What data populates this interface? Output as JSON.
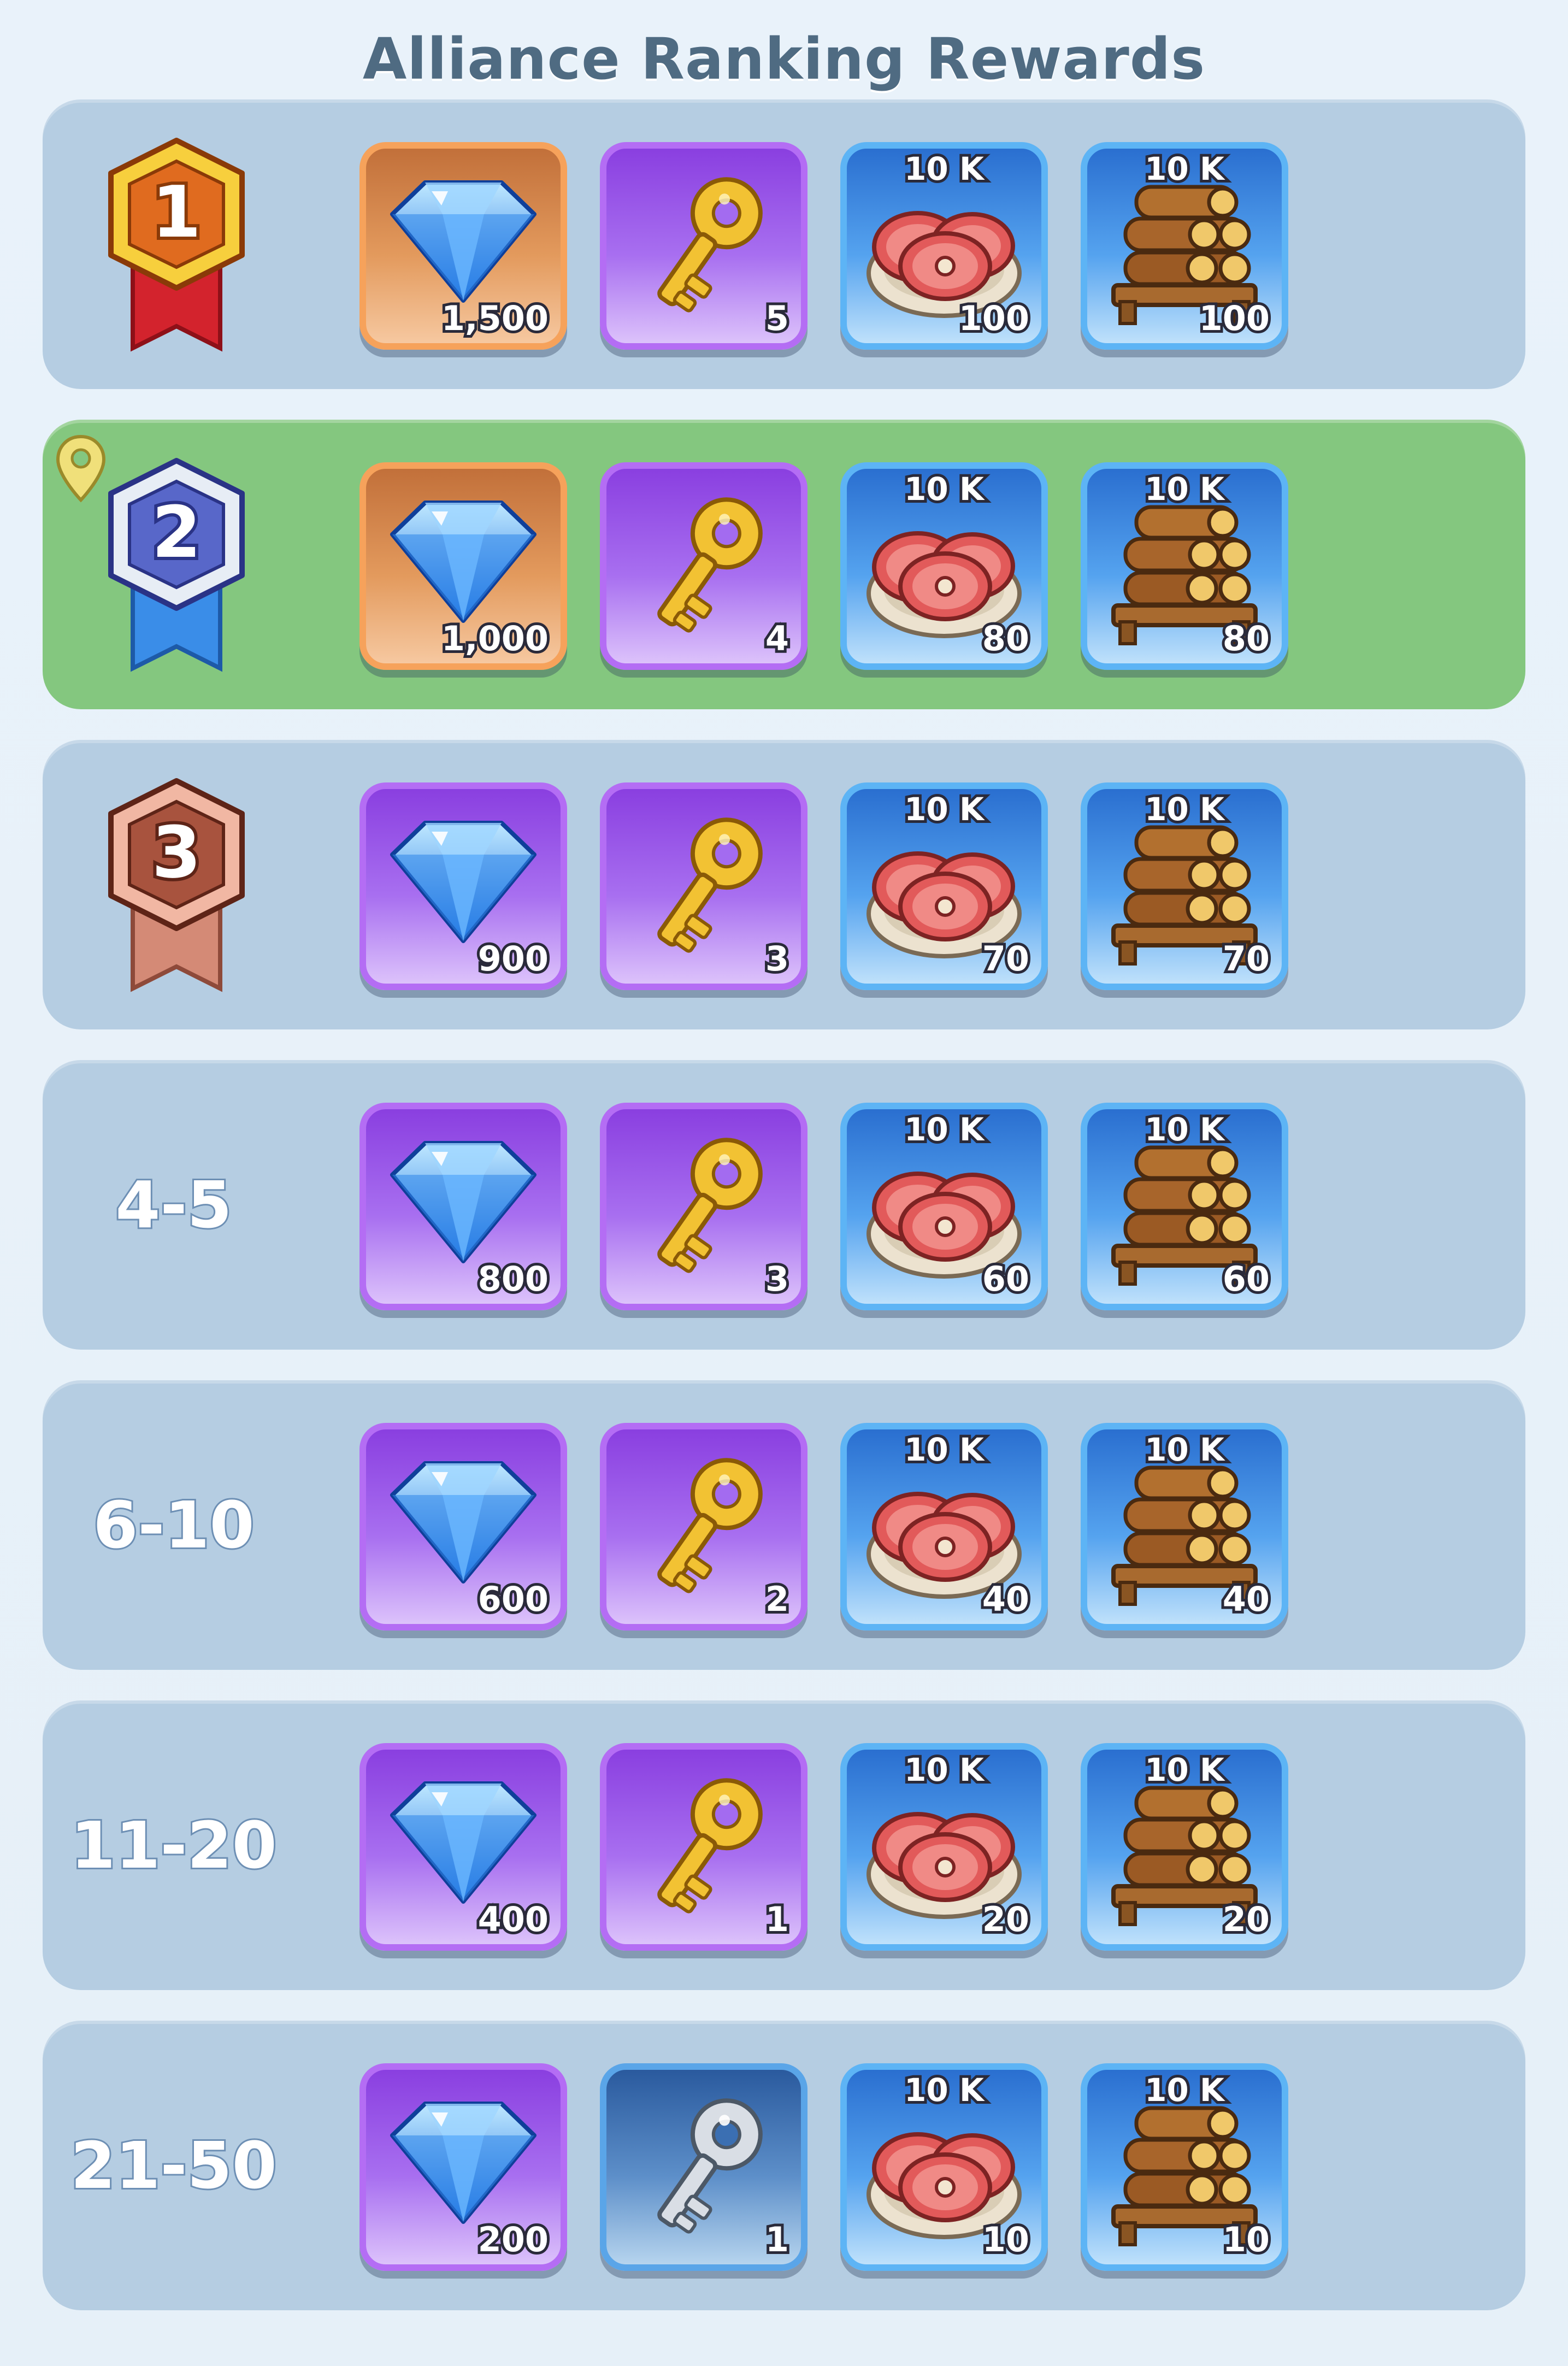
{
  "title": "Alliance Ranking Rewards",
  "colors": {
    "row_bg": "#b5cde2",
    "row_highlight": "#84c77f",
    "card_orange": "#f6a25b",
    "card_purple": "#b46df4",
    "card_blue": "#5db4f5"
  },
  "resource_tag": "10 K",
  "rows": [
    {
      "rank": "1",
      "rank_type": "gold-medal",
      "highlight": false,
      "rewards": [
        {
          "item": "diamond-icon",
          "frame": "orange",
          "qty": "1,500"
        },
        {
          "item": "gold-key-icon",
          "frame": "purple",
          "qty": "5"
        },
        {
          "item": "meat-icon",
          "frame": "blue",
          "qty": "100"
        },
        {
          "item": "wood-icon",
          "frame": "blue",
          "qty": "100"
        }
      ]
    },
    {
      "rank": "2",
      "rank_type": "silver-medal",
      "highlight": true,
      "rewards": [
        {
          "item": "diamond-icon",
          "frame": "orange",
          "qty": "1,000"
        },
        {
          "item": "gold-key-icon",
          "frame": "purple",
          "qty": "4"
        },
        {
          "item": "meat-icon",
          "frame": "blue",
          "qty": "80"
        },
        {
          "item": "wood-icon",
          "frame": "blue",
          "qty": "80"
        }
      ]
    },
    {
      "rank": "3",
      "rank_type": "bronze-medal",
      "highlight": false,
      "rewards": [
        {
          "item": "diamond-icon",
          "frame": "purple",
          "qty": "900"
        },
        {
          "item": "gold-key-icon",
          "frame": "purple",
          "qty": "3"
        },
        {
          "item": "meat-icon",
          "frame": "blue",
          "qty": "70"
        },
        {
          "item": "wood-icon",
          "frame": "blue",
          "qty": "70"
        }
      ]
    },
    {
      "rank": "4-5",
      "rank_type": "text",
      "highlight": false,
      "rewards": [
        {
          "item": "diamond-icon",
          "frame": "purple",
          "qty": "800"
        },
        {
          "item": "gold-key-icon",
          "frame": "purple",
          "qty": "3"
        },
        {
          "item": "meat-icon",
          "frame": "blue",
          "qty": "60"
        },
        {
          "item": "wood-icon",
          "frame": "blue",
          "qty": "60"
        }
      ]
    },
    {
      "rank": "6-10",
      "rank_type": "text",
      "highlight": false,
      "rewards": [
        {
          "item": "diamond-icon",
          "frame": "purple",
          "qty": "600"
        },
        {
          "item": "gold-key-icon",
          "frame": "purple",
          "qty": "2"
        },
        {
          "item": "meat-icon",
          "frame": "blue",
          "qty": "40"
        },
        {
          "item": "wood-icon",
          "frame": "blue",
          "qty": "40"
        }
      ]
    },
    {
      "rank": "11-20",
      "rank_type": "text",
      "highlight": false,
      "rewards": [
        {
          "item": "diamond-icon",
          "frame": "purple",
          "qty": "400"
        },
        {
          "item": "gold-key-icon",
          "frame": "purple",
          "qty": "1"
        },
        {
          "item": "meat-icon",
          "frame": "blue",
          "qty": "20"
        },
        {
          "item": "wood-icon",
          "frame": "blue",
          "qty": "20"
        }
      ]
    },
    {
      "rank": "21-50",
      "rank_type": "text",
      "highlight": false,
      "rewards": [
        {
          "item": "diamond-icon",
          "frame": "purple",
          "qty": "200"
        },
        {
          "item": "silver-key-icon",
          "frame": "steel",
          "qty": "1"
        },
        {
          "item": "meat-icon",
          "frame": "blue",
          "qty": "10"
        },
        {
          "item": "wood-icon",
          "frame": "blue",
          "qty": "10"
        }
      ]
    }
  ]
}
